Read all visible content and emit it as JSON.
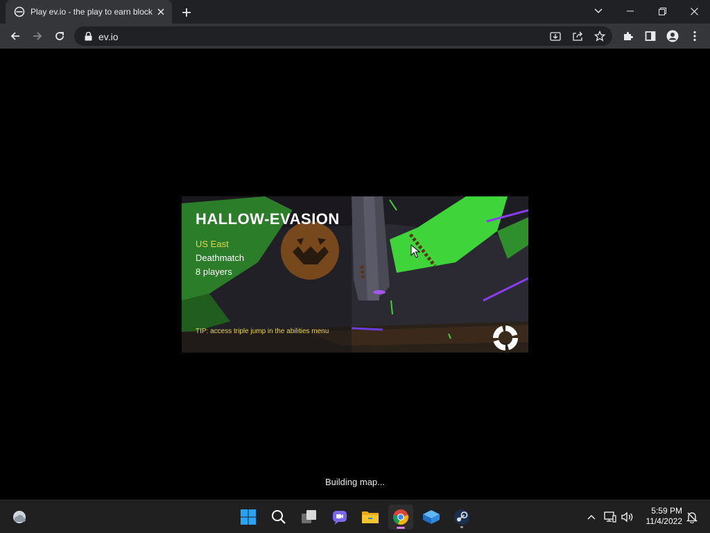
{
  "browser": {
    "tab_title": "Play ev.io - the play to earn blockchain FPS",
    "url": "ev.io",
    "icons": {
      "favicon": "ev-io-favicon",
      "tab_close": "close-icon",
      "new_tab": "plus-icon",
      "tab_search": "chevron-down-icon",
      "minimize": "minimize-icon",
      "restore": "restore-icon",
      "close_window": "close-icon",
      "back": "arrow-left-icon",
      "forward": "arrow-right-icon",
      "reload": "reload-icon",
      "lock": "lock-icon",
      "install": "install-icon",
      "share": "share-icon",
      "bookmark": "star-icon",
      "extensions": "puzzle-icon",
      "side_panel": "side-panel-icon",
      "profile": "profile-icon",
      "menu": "kebab-menu-icon"
    }
  },
  "game": {
    "map_name": "HALLOW-EVASION",
    "region": "US East",
    "mode": "Deathmatch",
    "players": "8 players",
    "tip": "TIP: access triple jump in the abilities menu",
    "status": "Building map...",
    "colors": {
      "region": "#e8d64a",
      "tip": "#e8d64a",
      "accent_green": "#3fd43a",
      "accent_purple": "#8a3cf0"
    }
  },
  "taskbar": {
    "apps": [
      {
        "name": "start",
        "icon": "windows-start-icon"
      },
      {
        "name": "search",
        "icon": "search-icon"
      },
      {
        "name": "task-view",
        "icon": "task-view-icon"
      },
      {
        "name": "chat",
        "icon": "chat-icon"
      },
      {
        "name": "file-explorer",
        "icon": "folder-icon"
      },
      {
        "name": "chrome",
        "icon": "chrome-icon",
        "active": true
      },
      {
        "name": "app-cube",
        "icon": "cube-icon"
      },
      {
        "name": "steam",
        "icon": "steam-icon"
      }
    ],
    "time": "5:59 PM",
    "date": "11/4/2022",
    "tray_icons": [
      "chevron-up-icon",
      "network-icon",
      "volume-icon",
      "notification-icon"
    ],
    "widgets_icon": "weather-icon"
  }
}
